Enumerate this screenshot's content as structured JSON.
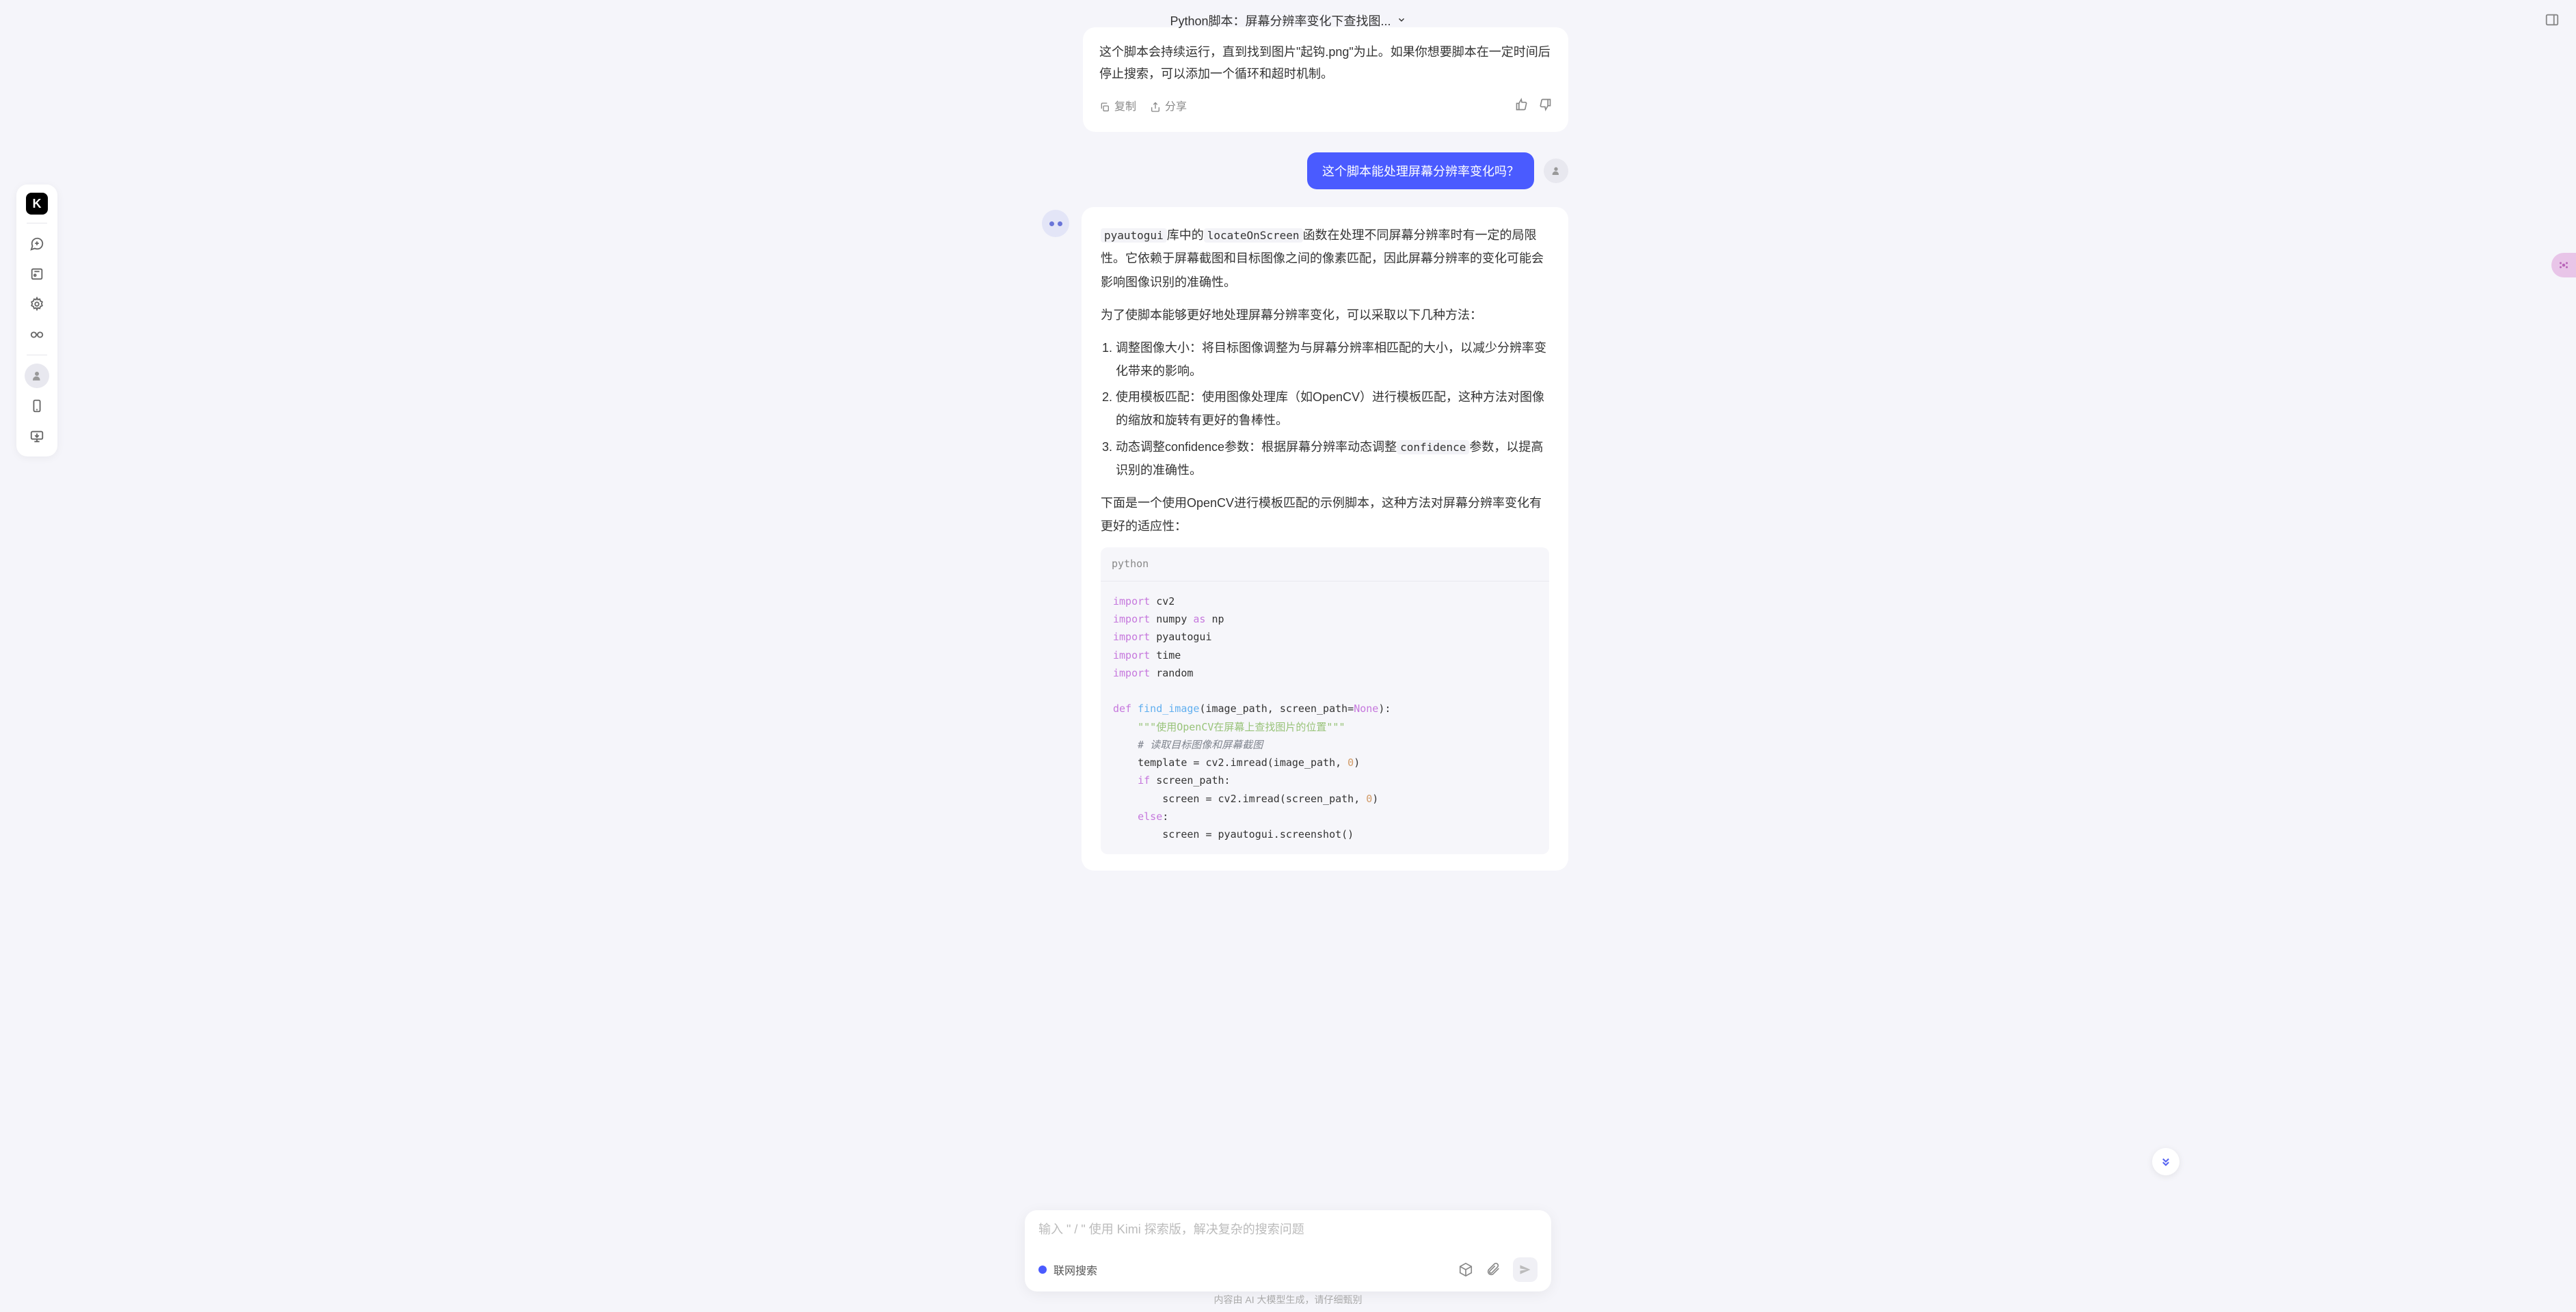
{
  "header": {
    "title": "Python脚本：屏幕分辨率变化下查找图..."
  },
  "sidebar": {
    "logo": "K"
  },
  "prev_assistant": {
    "text": "这个脚本会持续运行，直到找到图片\"起钩.png\"为止。如果你想要脚本在一定时间后停止搜索，可以添加一个循环和超时机制。",
    "copy_label": "复制",
    "share_label": "分享"
  },
  "user_msg": {
    "text": "这个脚本能处理屏幕分辨率变化吗？"
  },
  "assistant": {
    "para1_prefix": "库中的",
    "para1_suffix": "函数在处理不同屏幕分辨率时有一定的局限性。它依赖于屏幕截图和目标图像之间的像素匹配，因此屏幕分辨率的变化可能会影响图像识别的准确性。",
    "para1_code1": "pyautogui",
    "para1_code2": "locateOnScreen",
    "para2": "为了使脚本能够更好地处理屏幕分辨率变化，可以采取以下几种方法：",
    "li1": "调整图像大小：将目标图像调整为与屏幕分辨率相匹配的大小，以减少分辨率变化带来的影响。",
    "li2": "使用模板匹配：使用图像处理库（如OpenCV）进行模板匹配，这种方法对图像的缩放和旋转有更好的鲁棒性。",
    "li3_prefix": "动态调整confidence参数：根据屏幕分辨率动态调整",
    "li3_code": "confidence",
    "li3_suffix": "参数，以提高识别的准确性。",
    "para3": "下面是一个使用OpenCV进行模板匹配的示例脚本，这种方法对屏幕分辨率变化有更好的适应性：",
    "code_lang": "python"
  },
  "input": {
    "placeholder": "输入 \" / \" 使用 Kimi 探索版，解决复杂的搜索问题",
    "web_search_label": "联网搜索"
  },
  "disclaimer": "内容由 AI 大模型生成，请仔细甄别"
}
